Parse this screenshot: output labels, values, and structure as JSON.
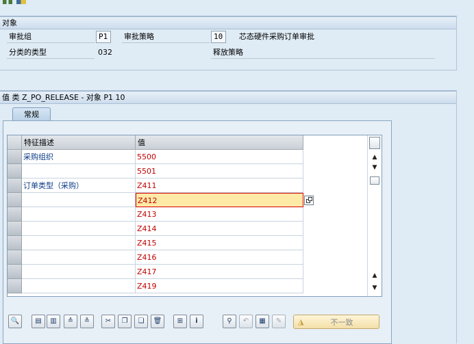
{
  "toolbar_top": {
    "icons": [
      "display-change-icon",
      "other-object-icon"
    ]
  },
  "object_section": {
    "title": "对象",
    "fields": {
      "approval_group_label": "审批组",
      "approval_group_value": "P1",
      "strategy_label": "审批策略",
      "strategy_value": "10",
      "strategy_desc": "芯态硬件采购订单审批",
      "class_type_label": "分类的类型",
      "class_type_value": "032",
      "release_strategy_label": "释放策略"
    }
  },
  "values_section": {
    "title": "值 类 Z_PO_RELEASE - 对象 P1 10",
    "tab_label": "常规",
    "columns": [
      "特征描述",
      "值"
    ],
    "rows": [
      {
        "desc": "采购组织",
        "value": "5500"
      },
      {
        "desc": "",
        "value": "5501"
      },
      {
        "desc": "订单类型（采购）",
        "value": "Z411"
      },
      {
        "desc": "",
        "value": "Z412"
      },
      {
        "desc": "",
        "value": "Z413"
      },
      {
        "desc": "",
        "value": "Z414"
      },
      {
        "desc": "",
        "value": "Z415"
      },
      {
        "desc": "",
        "value": "Z416"
      },
      {
        "desc": "",
        "value": "Z417"
      },
      {
        "desc": "",
        "value": "Z419"
      }
    ]
  },
  "bottom_toolbar": {
    "inconsistent_label": "不一致"
  }
}
